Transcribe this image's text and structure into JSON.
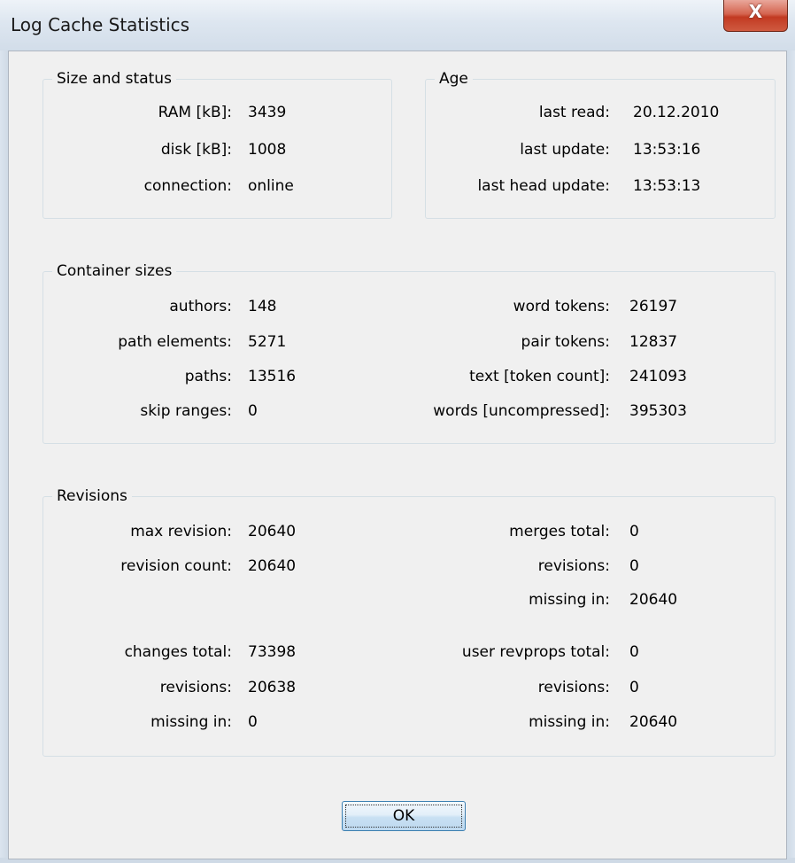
{
  "window": {
    "title": "Log Cache Statistics",
    "close_glyph": "X"
  },
  "size_status": {
    "label": "Size and status",
    "rows": [
      {
        "label": "RAM [kB]:",
        "value": "3439"
      },
      {
        "label": "disk [kB]:",
        "value": "1008"
      },
      {
        "label": "connection:",
        "value": "online"
      }
    ]
  },
  "age": {
    "label": "Age",
    "rows": [
      {
        "label": "last read:",
        "value": "20.12.2010"
      },
      {
        "label": "last update:",
        "value": "13:53:16"
      },
      {
        "label": "last head update:",
        "value": "13:53:13"
      }
    ]
  },
  "containers": {
    "label": "Container sizes",
    "left": [
      {
        "label": "authors:",
        "value": "148"
      },
      {
        "label": "path elements:",
        "value": "5271"
      },
      {
        "label": "paths:",
        "value": "13516"
      },
      {
        "label": "skip ranges:",
        "value": "0"
      }
    ],
    "right": [
      {
        "label": "word tokens:",
        "value": "26197"
      },
      {
        "label": "pair tokens:",
        "value": "12837"
      },
      {
        "label": "text [token count]:",
        "value": "241093"
      },
      {
        "label": "words [uncompressed]:",
        "value": "395303"
      }
    ]
  },
  "revisions": {
    "label": "Revisions",
    "left_top": [
      {
        "label": "max revision:",
        "value": "20640"
      },
      {
        "label": "revision count:",
        "value": "20640"
      }
    ],
    "left_bottom": [
      {
        "label": "changes total:",
        "value": "73398"
      },
      {
        "label": "revisions:",
        "value": "20638"
      },
      {
        "label": "missing in:",
        "value": "0"
      }
    ],
    "right_top": [
      {
        "label": "merges total:",
        "value": "0"
      },
      {
        "label": "revisions:",
        "value": "0"
      },
      {
        "label": "missing in:",
        "value": "20640"
      }
    ],
    "right_bottom": [
      {
        "label": "user revprops total:",
        "value": "0"
      },
      {
        "label": "revisions:",
        "value": "0"
      },
      {
        "label": "missing in:",
        "value": "20640"
      }
    ]
  },
  "buttons": {
    "ok": "OK"
  }
}
